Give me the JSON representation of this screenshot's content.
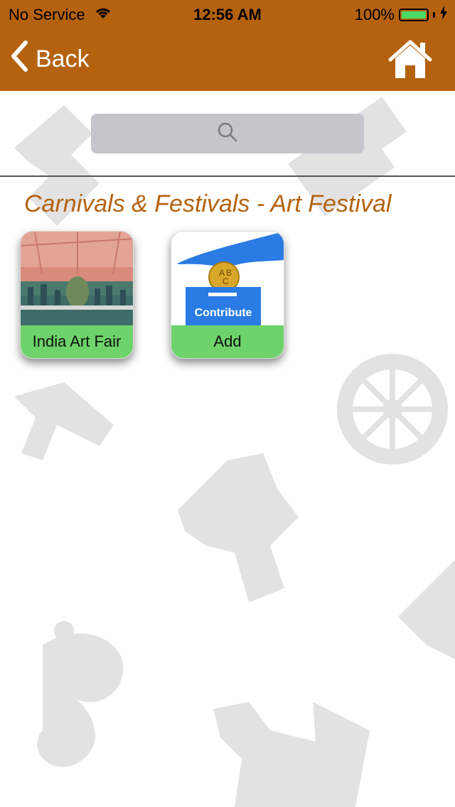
{
  "status_bar": {
    "carrier": "No Service",
    "time": "12:56 AM",
    "battery_percent": "100%",
    "battery_level": 1.0
  },
  "nav": {
    "back_label": "Back",
    "bar_color": "#b5620f",
    "home_icon": "home-icon"
  },
  "search": {
    "placeholder": "",
    "value": ""
  },
  "section": {
    "title": "Carnivals & Festivals - Art Festival"
  },
  "tiles": [
    {
      "label": "India Art Fair",
      "image": "art-fair-photo"
    },
    {
      "label": "Add",
      "image": "contribute-graphic",
      "image_text": "Contribute",
      "coin_letters": "ABC"
    }
  ],
  "colors": {
    "accent": "#b5620f",
    "tile_label_bg": "#6dd36a",
    "contribute_blue": "#2a7be4"
  }
}
